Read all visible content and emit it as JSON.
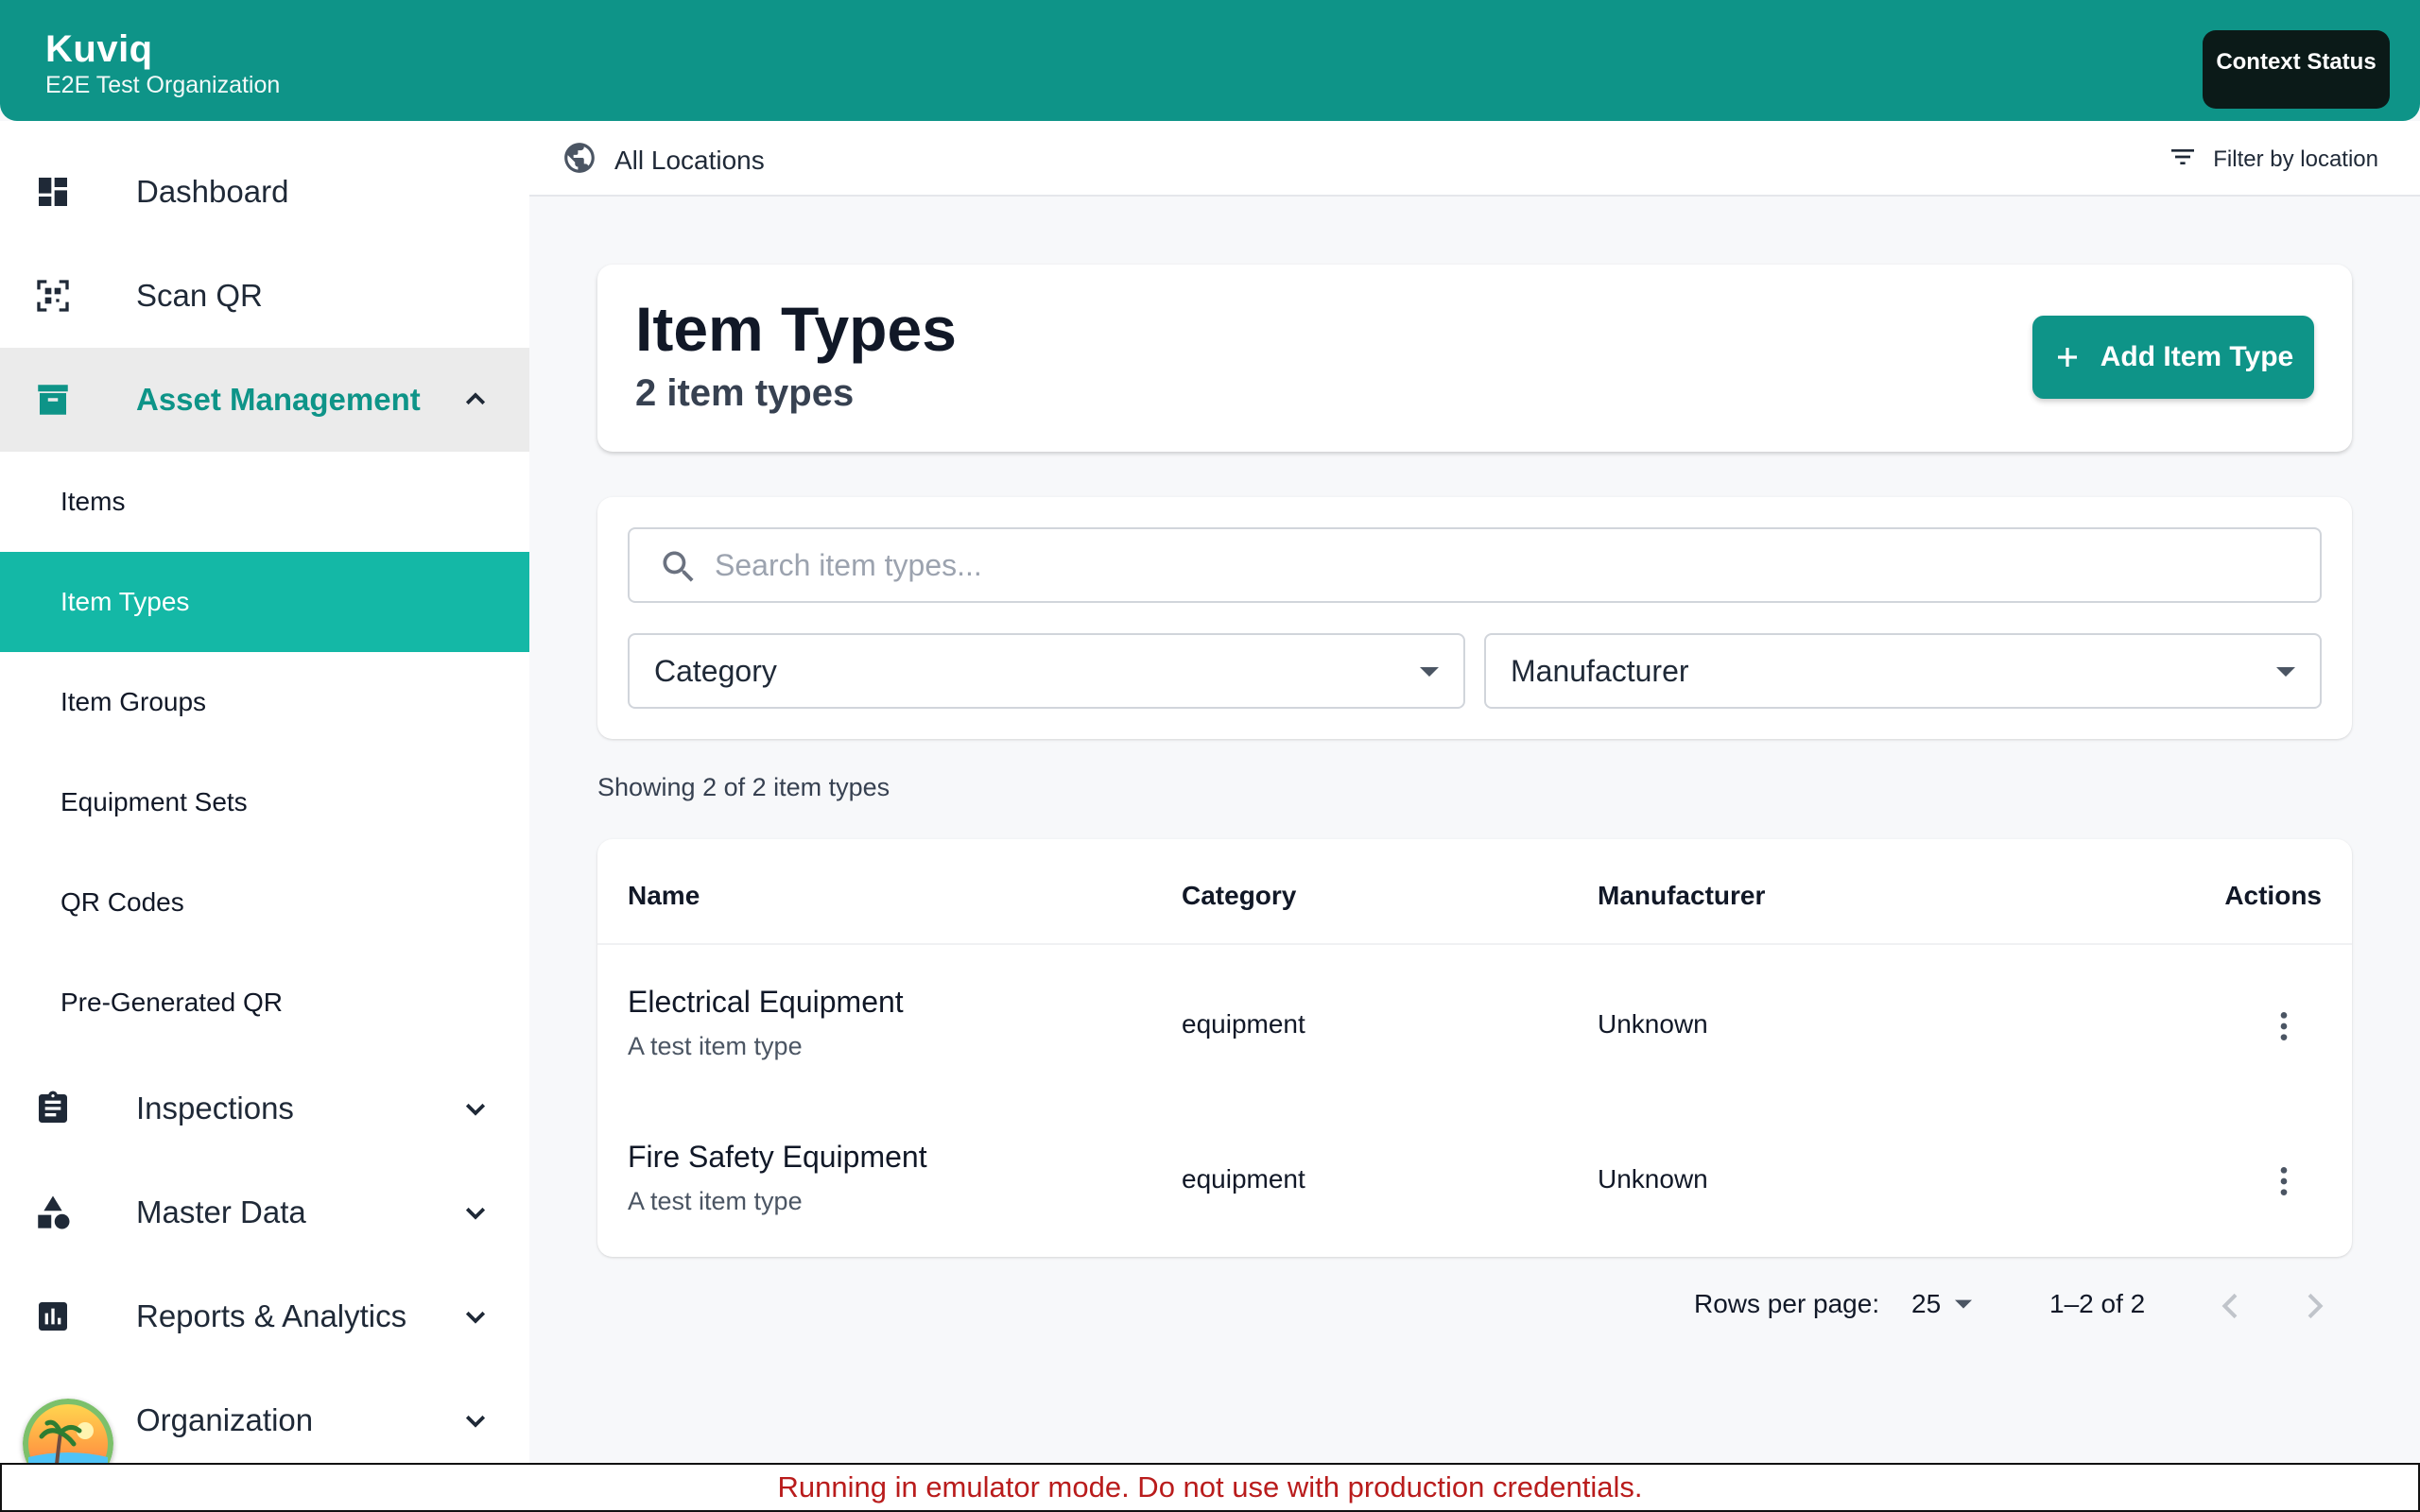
{
  "header": {
    "app_name": "Kuviq",
    "org_name": "E2E Test Organization",
    "context_button": "Context Status"
  },
  "sidebar": {
    "items": [
      {
        "label": "Dashboard",
        "icon": "dashboard-icon"
      },
      {
        "label": "Scan QR",
        "icon": "qr-scan-icon"
      },
      {
        "label": "Asset Management",
        "icon": "archive-icon",
        "expanded": true
      },
      {
        "label": "Inspections",
        "icon": "clipboard-icon"
      },
      {
        "label": "Master Data",
        "icon": "category-icon"
      },
      {
        "label": "Reports & Analytics",
        "icon": "bar-chart-icon"
      },
      {
        "label": "Organization",
        "icon": "organization-icon"
      }
    ],
    "sub_items": [
      {
        "label": "Items"
      },
      {
        "label": "Item Types",
        "active": true
      },
      {
        "label": "Item Groups"
      },
      {
        "label": "Equipment Sets"
      },
      {
        "label": "QR Codes"
      },
      {
        "label": "Pre-Generated QR"
      }
    ],
    "accent_color": "#0e9488",
    "active_color": "#14b8a6"
  },
  "location_bar": {
    "current": "All Locations",
    "filter_label": "Filter by location"
  },
  "page": {
    "title": "Item Types",
    "subtitle": "2 item types",
    "add_button": "Add Item Type"
  },
  "filters": {
    "search_placeholder": "Search item types...",
    "search_value": "",
    "category_label": "Category",
    "manufacturer_label": "Manufacturer"
  },
  "results": {
    "showing_text": "Showing 2 of 2 item types"
  },
  "table": {
    "columns": [
      "Name",
      "Category",
      "Manufacturer",
      "Actions"
    ],
    "rows": [
      {
        "name": "Electrical Equipment",
        "description": "A test item type",
        "category": "equipment",
        "manufacturer": "Unknown"
      },
      {
        "name": "Fire Safety Equipment",
        "description": "A test item type",
        "category": "equipment",
        "manufacturer": "Unknown"
      }
    ]
  },
  "pagination": {
    "rows_per_page_label": "Rows per page:",
    "rows_per_page_value": "25",
    "range_text": "1–2 of 2"
  },
  "banner": {
    "text": "Running in emulator mode. Do not use with production credentials.",
    "color": "#b91c1c"
  }
}
